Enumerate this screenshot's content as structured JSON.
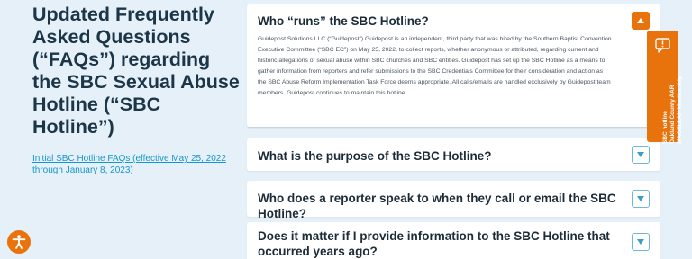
{
  "left": {
    "heading": "Updated Frequently Asked Questions (“FAQs”) regarding the SBC Sexual Abuse Hotline (“SBC Hotline”)",
    "link": "Initial SBC Hotline FAQs (effective May 25, 2022 through January 8, 2023)"
  },
  "faq": [
    {
      "question": "Who “runs” the SBC Hotline?",
      "expanded": true,
      "answer": "Guidepost Solutions LLC (“Guidepost”) Guidepost is an independent, third party that was hired by the Southern Baptist Convention Executive Committee (“SBC EC”) on May 25, 2022, to collect reports, whether anonymous or attributed, regarding current and historic allegations of sexual abuse within SBC churches and SBC entities. Guidepost has set up the SBC Hotline as a means to gather information from reporters and refer submissions to the SBC Credentials Committee for their consideration and action as the SBC Abuse Reform Implementation Task Force deems appropriate. All calls/emails are handled exclusively by Guidepost team members. Guidepost continues to maintain this hotline."
    },
    {
      "question": "What is the purpose of the SBC Hotline?",
      "expanded": false
    },
    {
      "question": "Who does a reporter speak to when they call or email the SBC Hotline?",
      "expanded": false
    },
    {
      "question": "Does it matter if I provide information to the SBC Hotline that occurred years ago?",
      "expanded": false
    }
  ],
  "side_tab": {
    "line1": "SBC hotline",
    "line2": "Oakland County AAR",
    "line3": "MAGELLAN Monitorship",
    "icon": "chat-alert-icon"
  },
  "accessibility": {
    "icon": "accessibility-icon"
  },
  "colors": {
    "background": "#e6f0f9",
    "accent": "#e8720c",
    "heading": "#1c3647",
    "link": "#1497c9",
    "toggle_border": "#6eb7d6"
  }
}
